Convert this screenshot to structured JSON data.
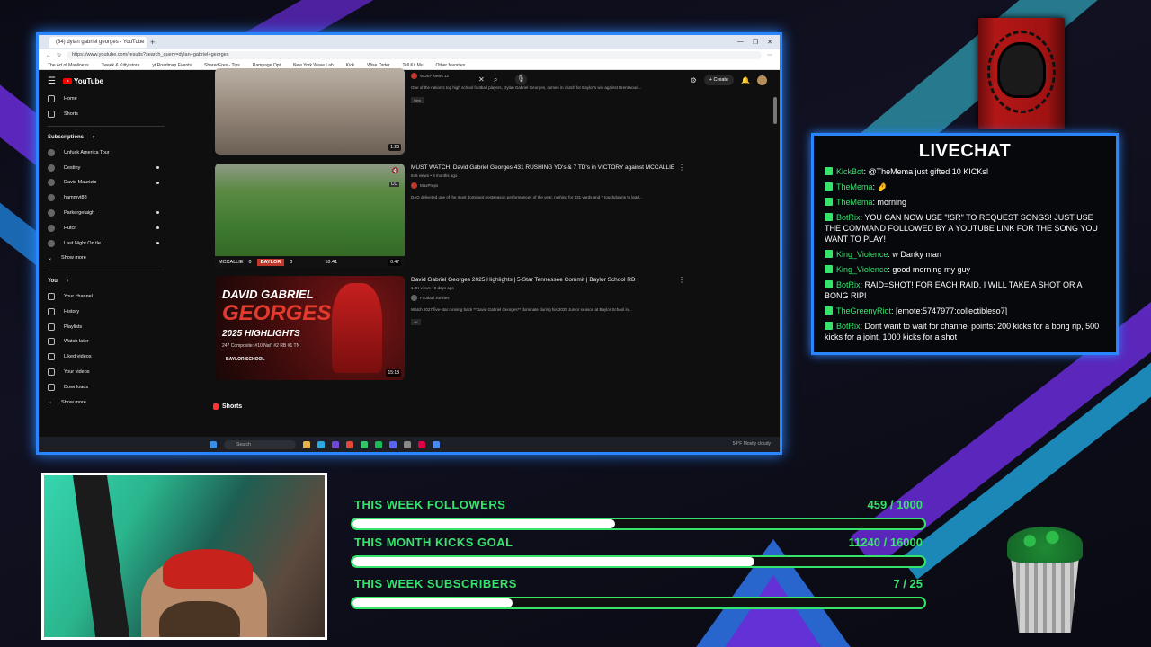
{
  "browser": {
    "tab_title": "(34) dylan gabriel georges - YouTube",
    "new_tab": "+",
    "url": "https://www.youtube.com/results?search_query=dylan+gabriel+georges",
    "bookmarks": [
      "The Art of Manliness",
      "Tweek & Kitty store",
      "yt Roadmap Events",
      "SharedFrex - Tips",
      "Rampage Opt",
      "New York Wave Lab",
      "Kick",
      "Wise Order",
      "Tell Kit Mu",
      "Other favorites"
    ],
    "window_controls": [
      "—",
      "❐",
      "✕"
    ]
  },
  "youtube": {
    "logo": "YouTube",
    "search_query": "dylan gabriel georges",
    "create_label": "Create",
    "notif_count": "9+"
  },
  "sidebar": {
    "items": [
      {
        "label": "Home",
        "icon": "home-icon"
      },
      {
        "label": "Shorts",
        "icon": "shorts-icon"
      }
    ],
    "subscriptions_header": "Subscriptions",
    "subscriptions": [
      "Unfuck America Tour",
      "Destiny",
      "David Maurizio",
      "hammyt88",
      "Parkergetaigh",
      "Hutch",
      "Last Night On tle..."
    ],
    "show_more": "Show more",
    "you_header": "You",
    "you_items": [
      "Your channel",
      "History",
      "Playlists",
      "Watch later",
      "Liked videos",
      "Your videos",
      "Downloads"
    ],
    "show_more_2": "Show more"
  },
  "videos": [
    {
      "title": "",
      "channel": "WDEF News 12",
      "desc": "One of the nation's top high school football players, Dylan Gabriel Georges, comes in clutch for Baylor's win against Brentwood...",
      "badge": "New",
      "duration": "1:26"
    },
    {
      "title": "MUST WATCH: David Gabriel Georges 431 RUSHING YD's & 7 TD's in VICTORY against MCCALLIE",
      "views": "646 views • 9 months ago",
      "channel": "MaxPreps",
      "desc": "DAG delivered one of the most dominant postseason performances of the year, rushing for 431 yards and 7 touchdowns to lead...",
      "scoreboard": {
        "team1": "MCCALLIE",
        "s1": "0",
        "team2": "BAYLOR",
        "s2": "0",
        "clock": "10:41"
      },
      "duration": "0:47"
    },
    {
      "title": "David Gabriel Georges 2025 Highlights | 5-Star Tennessee Commit | Baylor School RB",
      "views": "1.4K views • 8 days ago",
      "channel": "Football Junkies",
      "desc": "Watch 2027 five-star running back **David Gabriel Georges** dominate during his 2025 Junior season at Baylor School in...",
      "badge": "4K",
      "thumb_line1": "DAVID GABRIEL",
      "thumb_line2": "GEORGES",
      "thumb_line3": "2025 HIGHLIGHTS",
      "thumb_line4": "247 Composite: #10 Nat'l  #2 RB  #1 TN",
      "thumb_line5": "BAYLOR SCHOOL",
      "duration": "15:18"
    }
  ],
  "shorts_label": "Shorts",
  "taskbar": {
    "search": "Search",
    "weather": "54°F Mostly cloudy"
  },
  "livechat": {
    "title": "LIVECHAT",
    "messages": [
      {
        "user": "KickBot",
        "text": "@TheMema just gifted 10 KICKs!"
      },
      {
        "user": "TheMema",
        "text": "🤌"
      },
      {
        "user": "TheMema",
        "text": "morning"
      },
      {
        "user": "BotRix",
        "text": "YOU CAN NOW USE \"!SR\" TO REQUEST SONGS! JUST USE THE COMMAND FOLLOWED BY A YOUTUBE LINK FOR THE SONG YOU WANT TO PLAY!"
      },
      {
        "user": "King_Violence",
        "text": "w Danky man"
      },
      {
        "user": "King_Violence",
        "text": "good morning my guy"
      },
      {
        "user": "BotRix",
        "text": "RAID=SHOT! FOR EACH RAID, I WILL TAKE A SHOT OR A BONG RIP!"
      },
      {
        "user": "TheGreenyRiot",
        "text": "[emote:5747977:collectibleso7]"
      },
      {
        "user": "BotRix",
        "text": "Dont want to wait for channel points: 200 kicks for a bong rip, 500 kicks for a joint, 1000 kicks for a shot"
      }
    ]
  },
  "goals": [
    {
      "label": "THIS WEEK FOLLOWERS",
      "value": "459 / 1000",
      "fraction": 0.459
    },
    {
      "label": "THIS MONTH KICKS GOAL",
      "value": "11240 / 16000",
      "fraction": 0.7025
    },
    {
      "label": "THIS WEEK SUBSCRIBERS",
      "value": "7 / 25",
      "fraction": 0.28
    }
  ],
  "colors": {
    "accent": "#2a86ff",
    "goal_green": "#36e36b",
    "purple": "#6a2bd8"
  }
}
